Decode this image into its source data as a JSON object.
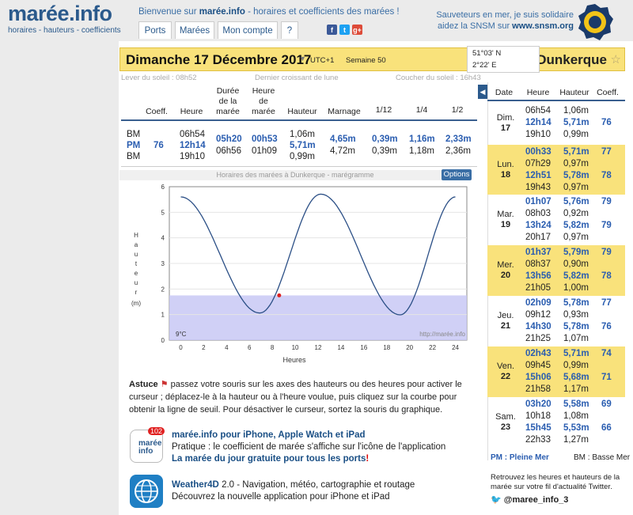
{
  "header": {
    "logo": "marée.info",
    "logo_sub": "horaires - hauteurs - coefficients",
    "welcome_pre": "Bienvenue sur ",
    "welcome_brand": "marée.info",
    "welcome_post": " - horaires et coefficients des marées !",
    "nav": [
      "Ports",
      "Marées",
      "Mon compte",
      "?"
    ],
    "social": [
      "f",
      "t",
      "g+"
    ],
    "snsm_line1": "Sauveteurs en mer, je suis solidaire",
    "snsm_line2_pre": "aidez la SNSM sur ",
    "snsm_line2_link": "www.snsm.org"
  },
  "datebar": {
    "date": "Dimanche 17 Décembre 2017",
    "utc": "UTC+1",
    "week": "Semaine 50",
    "lat": "51°03' N",
    "lon": "2°22' E",
    "city": "Dunkerque"
  },
  "sun": {
    "sunrise": "Lever du soleil : 08h52",
    "moon": "Dernier croissant de lune",
    "sunset": "Coucher du soleil : 16h43"
  },
  "table": {
    "headers": {
      "coeff": "Coeff.",
      "heure": "Heure",
      "duree": [
        "Durée",
        "de la",
        "marée"
      ],
      "heure_maree": [
        "Heure",
        "de",
        "marée"
      ],
      "hauteur": "Hauteur",
      "marnage": "Marnage",
      "h12": "1/12",
      "h4": "1/4",
      "h2": "1/2"
    },
    "types": [
      "BM",
      "PM",
      "BM"
    ],
    "coeff": "76",
    "heures": [
      "06h54",
      "12h14",
      "19h10"
    ],
    "durees": [
      "05h20",
      "06h56"
    ],
    "heures_maree": [
      "00h53",
      "01h09"
    ],
    "hauteurs": [
      "1,06m",
      "5,71m",
      "0,99m"
    ],
    "marnages": [
      "4,65m",
      "4,72m"
    ],
    "twelfth": [
      "0,39m",
      "0,39m"
    ],
    "quarter": [
      "1,16m",
      "1,18m"
    ],
    "half": [
      "2,33m",
      "2,36m"
    ]
  },
  "graph": {
    "title": "Horaires des marées à Dunkerque - marégramme",
    "options": "Options",
    "ylabel_letters": [
      "H",
      "a",
      "u",
      "t",
      "e",
      "u",
      "r"
    ],
    "yunit": "(m)",
    "xlabel": "Heures",
    "temp": "9°C",
    "watermark": "http://marée.info",
    "yticks": [
      "0",
      "1",
      "2",
      "3",
      "4",
      "5",
      "6"
    ],
    "xticks": [
      "0",
      "2",
      "4",
      "6",
      "8",
      "10",
      "12",
      "14",
      "16",
      "18",
      "20",
      "22",
      "24"
    ]
  },
  "chart_data": {
    "type": "line",
    "x": [
      0,
      6.9,
      12.23,
      19.17,
      24
    ],
    "series": [
      {
        "values": [
          5.6,
          1.06,
          5.71,
          0.99,
          5.6
        ]
      }
    ],
    "cursor": {
      "x": 8.6,
      "y": 1.75
    },
    "threshold": 1.75,
    "xlim": [
      -1,
      25
    ],
    "ylim": [
      0,
      6
    ],
    "xlabel": "Heures",
    "ylabel": "Hauteur (m)",
    "title": "Horaires des marées à Dunkerque - marégramme"
  },
  "astuce": {
    "label": "Astuce",
    "text": " passez votre souris sur les axes des hauteurs ou des heures pour activer le curseur ; déplacez-le à la hauteur ou à l'heure voulue, puis cliquez sur la courbe pour obtenir la ligne de seuil. Pour désactiver le curseur, sortez la souris du graphique."
  },
  "apps": [
    {
      "badge": "102",
      "icon_text": "marée info",
      "title": "marée.info pour iPhone, Apple Watch et iPad",
      "line2": "Pratique : le coefficient de marée s'affiche sur l'icône de l'application",
      "line3": "La marée du jour gratuite pour tous les ports",
      "line3_mark": "!"
    },
    {
      "title_bold": "Weather4D",
      "title": " 2.0 - Navigation, météo, cartographie et routage",
      "line2": "Découvrez la nouvelle application pour iPhone et iPad"
    }
  ],
  "side": {
    "headers": [
      "Date",
      "Heure",
      "Hauteur",
      "Coeff."
    ],
    "days": [
      {
        "name": "Dim.",
        "num": "17",
        "rows": [
          [
            "06h54",
            "1,06m",
            ""
          ],
          [
            "12h14",
            "5,71m",
            "76"
          ],
          [
            "19h10",
            "0,99m",
            ""
          ]
        ]
      },
      {
        "name": "Lun.",
        "num": "18",
        "rows": [
          [
            "00h33",
            "5,71m",
            "77"
          ],
          [
            "07h29",
            "0,97m",
            ""
          ],
          [
            "12h51",
            "5,78m",
            "78"
          ],
          [
            "19h43",
            "0,97m",
            ""
          ]
        ]
      },
      {
        "name": "Mar.",
        "num": "19",
        "rows": [
          [
            "01h07",
            "5,76m",
            "79"
          ],
          [
            "08h03",
            "0,92m",
            ""
          ],
          [
            "13h24",
            "5,82m",
            "79"
          ],
          [
            "20h17",
            "0,97m",
            ""
          ]
        ]
      },
      {
        "name": "Mer.",
        "num": "20",
        "rows": [
          [
            "01h37",
            "5,79m",
            "79"
          ],
          [
            "08h37",
            "0,90m",
            ""
          ],
          [
            "13h56",
            "5,82m",
            "78"
          ],
          [
            "21h05",
            "1,00m",
            ""
          ]
        ]
      },
      {
        "name": "Jeu.",
        "num": "21",
        "rows": [
          [
            "02h09",
            "5,78m",
            "77"
          ],
          [
            "09h12",
            "0,93m",
            ""
          ],
          [
            "14h30",
            "5,78m",
            "76"
          ],
          [
            "21h25",
            "1,07m",
            ""
          ]
        ]
      },
      {
        "name": "Ven.",
        "num": "22",
        "rows": [
          [
            "02h43",
            "5,71m",
            "74"
          ],
          [
            "09h45",
            "0,99m",
            ""
          ],
          [
            "15h06",
            "5,68m",
            "71"
          ],
          [
            "21h58",
            "1,17m",
            ""
          ]
        ]
      },
      {
        "name": "Sam.",
        "num": "23",
        "rows": [
          [
            "03h20",
            "5,58m",
            "69"
          ],
          [
            "10h18",
            "1,08m",
            ""
          ],
          [
            "15h45",
            "5,53m",
            "66"
          ],
          [
            "22h33",
            "1,27m",
            ""
          ]
        ]
      }
    ],
    "legend_pm": "PM : Pleine Mer",
    "legend_bm": "BM : Basse Mer",
    "footer": "Retrouvez les heures et hauteurs de la marée sur votre fil d'actualité Twitter.",
    "twitter": "@maree_info_3"
  },
  "colors": {
    "accent": "#2a5db0",
    "yellow": "#f9e27b",
    "navy": "#2b5a8c"
  }
}
